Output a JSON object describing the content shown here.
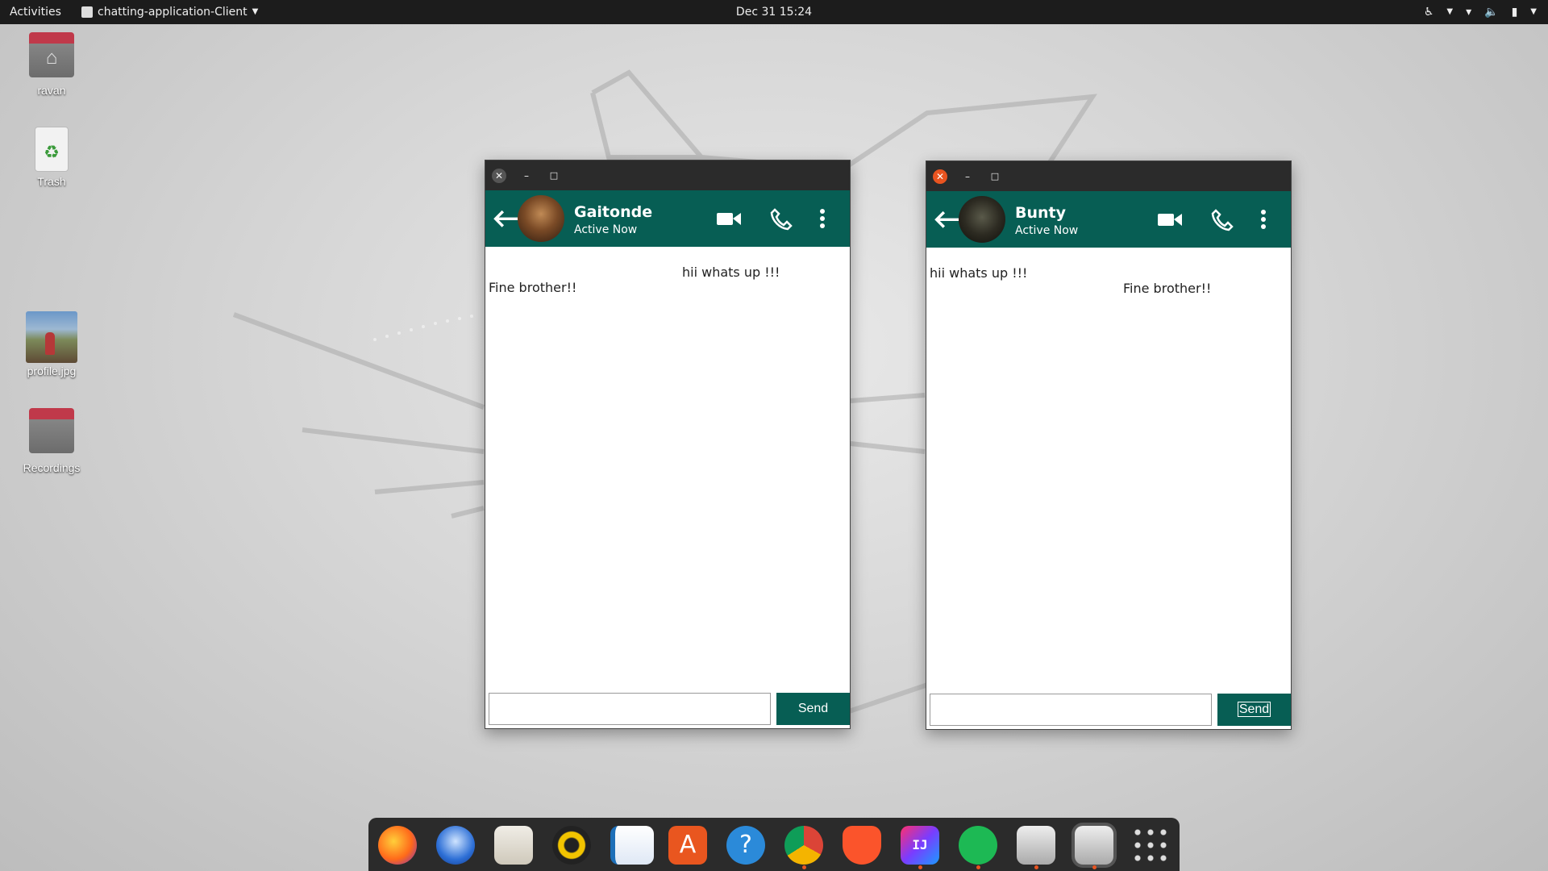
{
  "topbar": {
    "activities": "Activities",
    "app_name": "chatting-application-Client",
    "clock": "Dec 31  15:24"
  },
  "desktop": {
    "icons": [
      {
        "label": "ravan",
        "icon": "home-folder-icon"
      },
      {
        "label": "Trash",
        "icon": "trash-icon"
      },
      {
        "label": "profile.jpg",
        "icon": "image-thumbnail-icon"
      },
      {
        "label": "Recordings",
        "icon": "folder-icon"
      }
    ]
  },
  "windows": [
    {
      "contact_name": "Gaitonde",
      "status": "Active Now",
      "messages": [
        {
          "text": "hii whats up !!!",
          "side": "right"
        },
        {
          "text": "Fine brother!!",
          "side": "left"
        }
      ],
      "input_value": "",
      "send_label": "Send"
    },
    {
      "contact_name": "Bunty",
      "status": "Active Now",
      "messages": [
        {
          "text": "hii whats up !!!",
          "side": "left"
        },
        {
          "text": "Fine brother!!",
          "side": "right"
        }
      ],
      "input_value": "",
      "send_label": "Send"
    }
  ],
  "dock": {
    "apps": [
      "firefox-icon",
      "thunderbird-icon",
      "files-icon",
      "rhythmbox-icon",
      "libreoffice-writer-icon",
      "software-center-icon",
      "help-icon",
      "chrome-icon",
      "brave-icon",
      "intellij-icon",
      "spotify-icon",
      "java-app-icon",
      "java-app-icon",
      "show-apps-icon"
    ]
  },
  "colors": {
    "header": "#075e54",
    "topbar": "#1c1c1c",
    "accent": "#e95420"
  }
}
